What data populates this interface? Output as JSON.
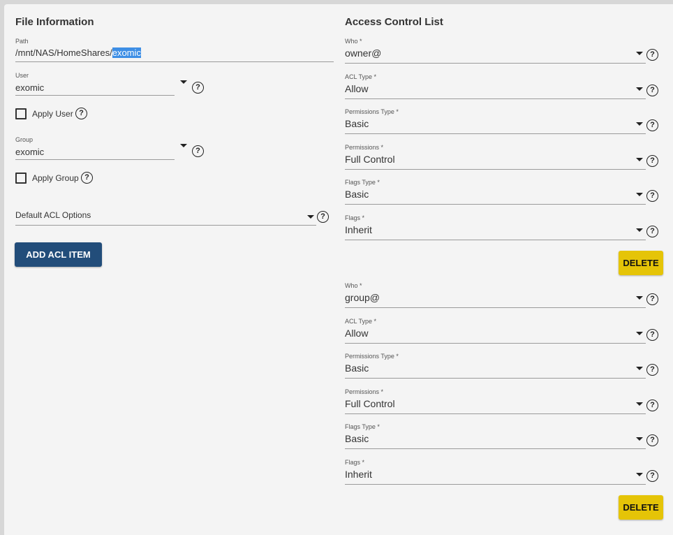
{
  "file_info": {
    "title": "File Information",
    "path_label": "Path",
    "path_prefix": "/mnt/NAS/HomeShares/",
    "path_selected": "exomic",
    "user_label": "User",
    "user_value": "exomic",
    "apply_user_label": "Apply User",
    "group_label": "Group",
    "group_value": "exomic",
    "apply_group_label": "Apply Group",
    "default_acl_label": "Default ACL Options",
    "add_button": "ADD ACL ITEM",
    "help_glyph": "?"
  },
  "acl": {
    "title": "Access Control List",
    "delete_label": "DELETE",
    "entries": [
      {
        "who_label": "Who *",
        "who": "owner@",
        "acl_type_label": "ACL Type *",
        "acl_type": "Allow",
        "perm_type_label": "Permissions Type *",
        "perm_type": "Basic",
        "permissions_label": "Permissions *",
        "permissions": "Full Control",
        "flags_type_label": "Flags Type *",
        "flags_type": "Basic",
        "flags_label": "Flags *",
        "flags": "Inherit"
      },
      {
        "who_label": "Who *",
        "who": "group@",
        "acl_type_label": "ACL Type *",
        "acl_type": "Allow",
        "perm_type_label": "Permissions Type *",
        "perm_type": "Basic",
        "permissions_label": "Permissions *",
        "permissions": "Full Control",
        "flags_type_label": "Flags Type *",
        "flags_type": "Basic",
        "flags_label": "Flags *",
        "flags": "Inherit"
      }
    ]
  },
  "colors": {
    "primary_button": "#224d7a",
    "delete_button": "#e5c407",
    "selection": "#3d8ee5"
  }
}
